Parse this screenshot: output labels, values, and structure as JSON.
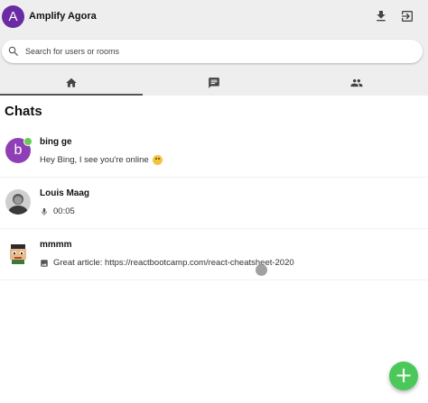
{
  "header": {
    "avatar_letter": "A",
    "title": "Amplify Agora",
    "icons": [
      "download-icon",
      "logout-icon"
    ]
  },
  "search": {
    "placeholder": "Search for users or rooms",
    "value": ""
  },
  "tabs": [
    {
      "icon": "home-icon",
      "active": true
    },
    {
      "icon": "chat-bubble-icon",
      "active": false
    },
    {
      "icon": "people-icon",
      "active": false
    }
  ],
  "section": {
    "title": "Chats"
  },
  "chats": [
    {
      "name": "bing ge",
      "avatar_letter": "b",
      "online": true,
      "preview": "Hey Bing, I see you're online",
      "preview_emoji": "smiling-face"
    },
    {
      "name": "Louis Maag",
      "avatar": "photo",
      "preview_icon": "mic-icon",
      "preview": "00:05"
    },
    {
      "name": "mmmm",
      "avatar": "pixel-art",
      "preview_icon": "image-icon",
      "preview": "Great article: https://reactbootcamp.com/react-cheatsheet-2020"
    }
  ],
  "fab": {
    "label": "+"
  },
  "colors": {
    "header_bg": "#eeeeee",
    "app_avatar": "#6a2aa4",
    "chat_avatar_b": "#8e3fb5",
    "online": "#66cc55",
    "fab": "#4cc85a"
  }
}
